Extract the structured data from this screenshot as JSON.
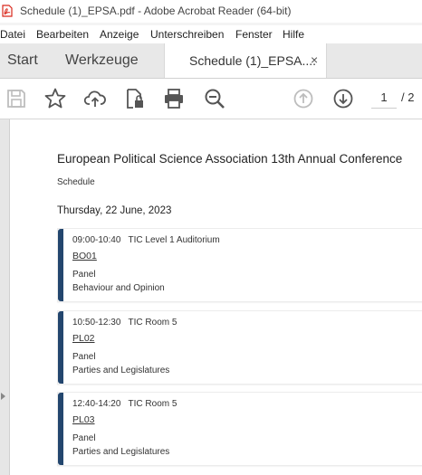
{
  "window": {
    "title": "Schedule (1)_EPSA.pdf - Adobe Acrobat Reader (64-bit)"
  },
  "menu": [
    "Datei",
    "Bearbeiten",
    "Anzeige",
    "Unterschreiben",
    "Fenster",
    "Hilfe"
  ],
  "tabs": {
    "start": "Start",
    "tools": "Werkzeuge",
    "document": "Schedule (1)_EPSA....",
    "close": "×"
  },
  "toolbar": {
    "page_current": "1",
    "page_total": "/ 2"
  },
  "document": {
    "title": "European Political Science Association 13th Annual Conference",
    "subtitle": "Schedule",
    "date": "Thursday, 22 June, 2023",
    "sessions": [
      {
        "time": "09:00-10:40   TIC Level 1 Auditorium",
        "code": "BO01",
        "type": "Panel",
        "topic": "Behaviour and Opinion"
      },
      {
        "time": "10:50-12:30   TIC Room 5",
        "code": "PL02",
        "type": "Panel",
        "topic": "Parties and Legislatures"
      },
      {
        "time": "12:40-14:20   TIC Room 5",
        "code": "PL03",
        "type": "Panel",
        "topic": "Parties and Legislatures"
      }
    ]
  },
  "colors": {
    "accent_bar": "#23466e",
    "pdf_icon": "#d9281c"
  },
  "icons": [
    "pdf-icon",
    "save-icon",
    "bookmark-star-icon",
    "cloud-upload-icon",
    "lock-file-icon",
    "print-icon",
    "zoom-out-icon",
    "page-up-icon",
    "page-down-icon",
    "close-icon",
    "collapse-arrow-icon"
  ]
}
